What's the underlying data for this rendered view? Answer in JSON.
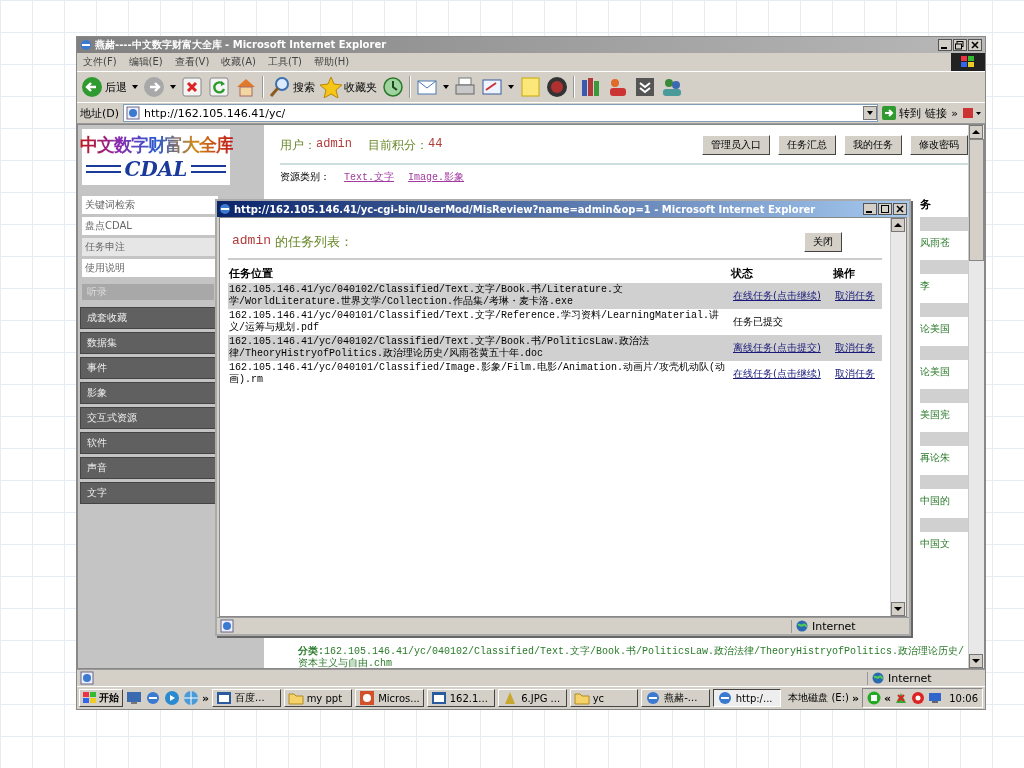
{
  "window": {
    "title": "燕赭----中文数字财富大全库 - Microsoft Internet Explorer"
  },
  "menu": [
    "文件(F)",
    "编辑(E)",
    "查看(V)",
    "收藏(A)",
    "工具(T)",
    "帮助(H)"
  ],
  "toolbar": [
    {
      "kind": "back",
      "label": "后退",
      "dropdown": true
    },
    {
      "kind": "forward",
      "dropdown": true
    },
    {
      "kind": "stop"
    },
    {
      "kind": "refresh"
    },
    {
      "kind": "home"
    },
    {
      "kind": "search",
      "label": "搜索"
    },
    {
      "kind": "favorites",
      "label": "收藏夹"
    },
    {
      "kind": "history"
    },
    {
      "kind": "mail",
      "dropdown": true
    },
    {
      "kind": "print"
    },
    {
      "kind": "edit",
      "dropdown": true
    },
    {
      "kind": "note"
    },
    {
      "kind": "badge"
    },
    {
      "kind": "books"
    },
    {
      "kind": "people"
    },
    {
      "kind": "box"
    },
    {
      "kind": "users"
    }
  ],
  "address": {
    "label": "地址(D)",
    "value": "http://162.105.146.41/yc/",
    "go": "转到",
    "links": "链接",
    "more": "»"
  },
  "site": {
    "logo": "中文数字财富大全库",
    "logo_sub": "CDAL",
    "nav": [
      {
        "label": "关键词检索",
        "selected": false
      },
      {
        "label": "盘点CDAL",
        "selected": false
      },
      {
        "label": "任务申注",
        "selected": true
      },
      {
        "label": "使用说明",
        "selected": false
      }
    ],
    "section_label": "听录",
    "categories": [
      "成套收藏",
      "数据集",
      "事件",
      "影象",
      "交互式资源",
      "软件",
      "声音",
      "文字"
    ],
    "user_label": "用户：",
    "user": "admin",
    "score_label": "目前积分：",
    "score": "44",
    "buttons": [
      "管理员入口",
      "任务汇总",
      "我的任务",
      "修改密码"
    ],
    "resource_label": "资源类别：",
    "resource_links": [
      "Text.文字",
      "Image.影象"
    ],
    "column_heading": "务",
    "column_items": [
      "风雨苍",
      "李",
      "论美国",
      "论美国",
      "美国宪",
      "再论朱",
      "中国的",
      "中国文"
    ],
    "classification_label": "分类:",
    "classification": "162.105.146.41/yc/040102/Classified/Text.文字/Book.书/PoliticsLaw.政治法律/TheoryHistryofPolitics.政治理论历史/资本主义与自由.chm"
  },
  "popup": {
    "title": "http://162.105.146.41/yc-cgi-bin/UserMod/MisReview?name=admin&op=1 - Microsoft Internet Explorer",
    "user": "admin",
    "heading": "的任务列表：",
    "close": "关闭",
    "columns": [
      "任务位置",
      "状态",
      "操作"
    ],
    "rows": [
      {
        "path": "162.105.146.41/yc/040102/Classified/Text.文字/Book.书/Literature.文学/WorldLiterature.世界文学/Collection.作品集/考琳・麦卡洛.exe",
        "status": "在线任务(点击继续)",
        "kind": "link",
        "action": "取消任务"
      },
      {
        "path": "162.105.146.41/yc/040101/Classified/Text.文字/Reference.学习资料/LearningMaterial.讲义/运筹与规划.pdf",
        "status": "任务已提交",
        "kind": "text"
      },
      {
        "path": "162.105.146.41/yc/040102/Classified/Text.文字/Book.书/PoliticsLaw.政治法律/TheoryHistryofPolitics.政治理论历史/风雨苍黄五十年.doc",
        "status": "离线任务(点击提交)",
        "kind": "link",
        "action": "取消任务"
      },
      {
        "path": "162.105.146.41/yc/040101/Classified/Image.影象/Film.电影/Animation.动画片/攻壳机动队(动画).rm",
        "status": "在线任务(点击继续)",
        "kind": "link",
        "action": "取消任务"
      }
    ],
    "status_zone": "Internet"
  },
  "status_bar": {
    "zone": "Internet"
  },
  "taskbar": {
    "start": "开始",
    "quick_launch": [
      {
        "kind": "desktop"
      },
      {
        "kind": "ie"
      },
      {
        "kind": "media"
      },
      {
        "kind": "browser"
      }
    ],
    "more": "»",
    "tasks": [
      {
        "label": "百度...",
        "kind": "app",
        "selected": false
      },
      {
        "label": "my ppt",
        "kind": "folder",
        "selected": false
      },
      {
        "label": "Micros...",
        "kind": "ppt",
        "selected": false
      },
      {
        "label": "162.1...",
        "kind": "app",
        "selected": false
      },
      {
        "label": "6.JPG ...",
        "kind": "image",
        "selected": false
      },
      {
        "label": "yc",
        "kind": "folder",
        "selected": false
      },
      {
        "label": "燕赭-...",
        "kind": "ie",
        "selected": false
      },
      {
        "label": "http:/...",
        "kind": "ie",
        "selected": true
      }
    ],
    "drive": "本地磁盘 (E:)",
    "drive_more": "»",
    "tray_more": "«",
    "clock": "10:06"
  }
}
